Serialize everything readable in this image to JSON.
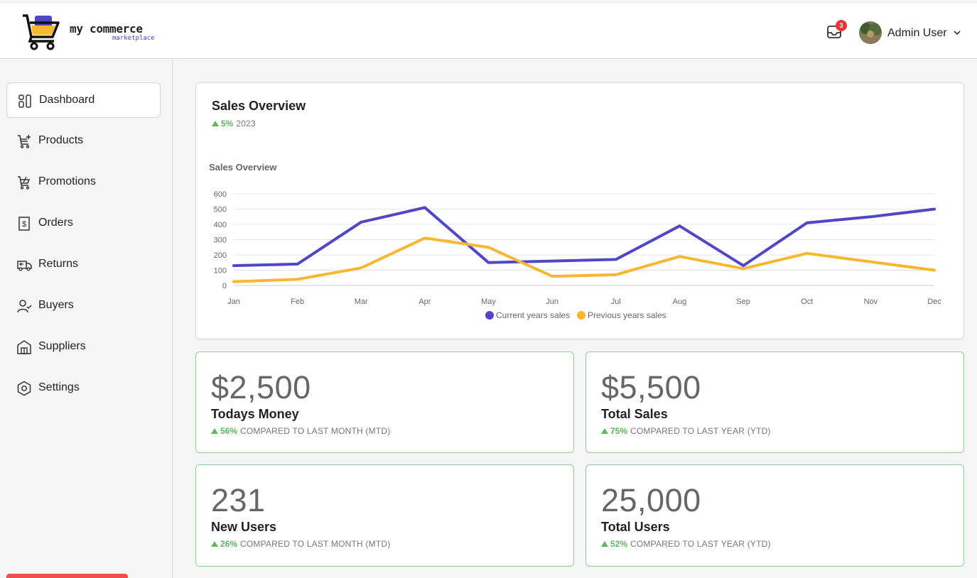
{
  "header": {
    "logo_text": "my commerce",
    "logo_sub": "marketplace",
    "inbox_badge": "3",
    "user_name": "Admin User"
  },
  "sidebar": {
    "items": [
      {
        "label": "Dashboard",
        "icon": "dashboard-icon",
        "active": true
      },
      {
        "label": "Products",
        "icon": "cart-plus-icon"
      },
      {
        "label": "Promotions",
        "icon": "cart-discount-icon"
      },
      {
        "label": "Orders",
        "icon": "receipt-dollar-icon"
      },
      {
        "label": "Returns",
        "icon": "truck-return-icon"
      },
      {
        "label": "Buyers",
        "icon": "user-check-icon"
      },
      {
        "label": "Suppliers",
        "icon": "building-store-icon"
      },
      {
        "label": "Settings",
        "icon": "settings-hexagon-icon"
      }
    ]
  },
  "sales_overview": {
    "title": "Sales Overview",
    "trend_pct": "5%",
    "trend_label": "2023"
  },
  "chart_data": {
    "type": "line",
    "title": "Sales Overview",
    "categories": [
      "Jan",
      "Feb",
      "Mar",
      "Apr",
      "May",
      "Jun",
      "Jul",
      "Aug",
      "Sep",
      "Oct",
      "Nov",
      "Dec"
    ],
    "ylim": [
      0,
      600
    ],
    "yticks": [
      0,
      100,
      200,
      300,
      400,
      500,
      600
    ],
    "grid": true,
    "legend": "bottom",
    "series": [
      {
        "name": "Current years sales",
        "color": "#5046c8",
        "values": [
          130,
          140,
          415,
          510,
          150,
          160,
          170,
          390,
          130,
          410,
          450,
          500
        ]
      },
      {
        "name": "Previous years sales",
        "color": "#f7b731",
        "values": [
          25,
          40,
          115,
          310,
          250,
          60,
          70,
          190,
          110,
          210,
          155,
          100
        ]
      }
    ]
  },
  "stats": [
    {
      "value": "$2,500",
      "label": "Todays Money",
      "pct": "56%",
      "note": "COMPARED TO LAST MONTH (MTD)"
    },
    {
      "value": "$5,500",
      "label": "Total Sales",
      "pct": "75%",
      "note": "COMPARED TO LAST YEAR (YTD)"
    },
    {
      "value": "231",
      "label": "New Users",
      "pct": "26%",
      "note": "COMPARED TO LAST MONTH (MTD)"
    },
    {
      "value": "25,000",
      "label": "Total Users",
      "pct": "52%",
      "note": "COMPARED TO LAST YEAR (YTD)"
    }
  ],
  "colors": {
    "accent": "#5046c8",
    "secondary": "#f7b731",
    "positive": "#5cb85c",
    "badge": "#e53935"
  }
}
